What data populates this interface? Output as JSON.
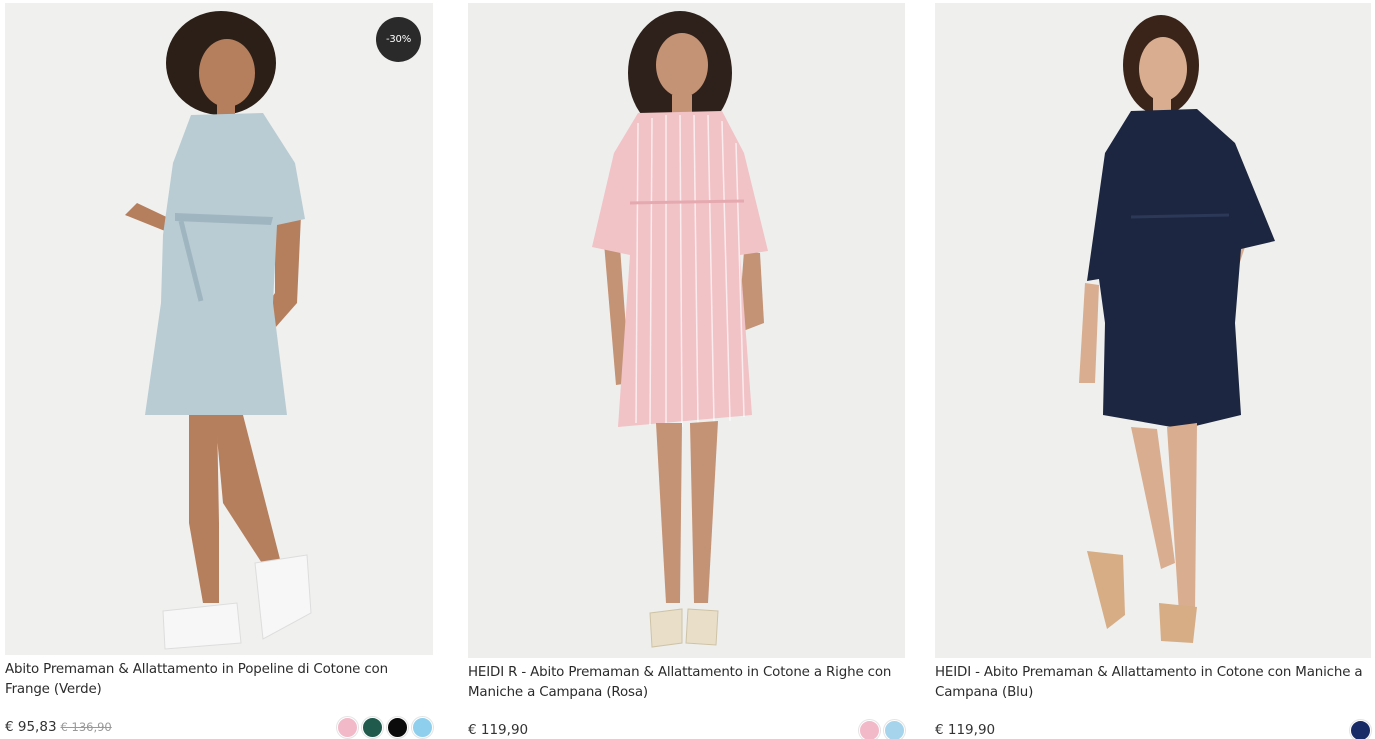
{
  "products": [
    {
      "title": "Abito Premaman & Allattamento in Popeline di Cotone con Frange (Verde)",
      "price": "€ 95,83",
      "old_price": "€ 136,90",
      "badge": "-30%",
      "dress_color": "#b9ccd3",
      "swatches": [
        "#f2b9c9",
        "#1f5a4c",
        "#0b0b0b",
        "#8fcfee"
      ]
    },
    {
      "title": "HEIDI R - Abito Premaman & Allattamento in Cotone a Righe con Maniche a Campana (Rosa)",
      "price": "€ 119,90",
      "dress_color": "#f1c2c6",
      "swatches": [
        "#f2b9c9",
        "#a6d4ec"
      ]
    },
    {
      "title": "HEIDI - Abito Premaman & Allattamento in Cotone con Maniche a Campana (Blu)",
      "price": "€ 119,90",
      "dress_color": "#1c2640",
      "swatches": [
        "#182b66"
      ]
    }
  ]
}
